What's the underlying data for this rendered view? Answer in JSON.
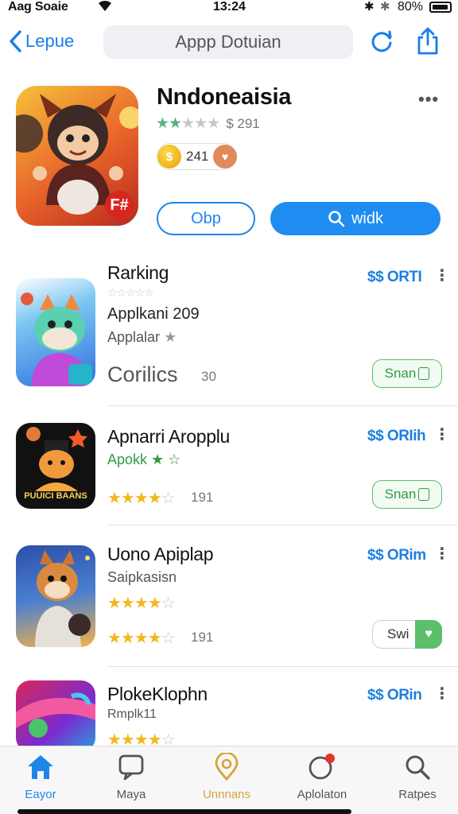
{
  "status_bar": {
    "carrier": "Aag Soaie",
    "time": "13:24",
    "battery": "80%"
  },
  "nav": {
    "back_label": "Lepue",
    "search_text": "Appp Dotuian"
  },
  "hero": {
    "title": "Nndoneaisia",
    "rating_count": "291",
    "coins": "241",
    "open_label": "Obp",
    "action_label": "widk",
    "badge": "F#"
  },
  "apps": [
    {
      "name": "Rarking",
      "line1": "Applkani 209",
      "line2": "Applalar",
      "extra": "Corilics",
      "extra_count": "30",
      "price": "$$ ORTI",
      "button": "Snan"
    },
    {
      "name": "Apnarri Aropplu",
      "line1": "Apokk",
      "icon_text": "PUUICI BAANS",
      "price": "$$ ORIih",
      "rating_count": "191",
      "button": "Snan"
    },
    {
      "name": "Uono  Apiplap",
      "line1": "Saipkasisn",
      "price": "$$ ORim",
      "rating_count": "191",
      "button": "Swi"
    },
    {
      "name": "PlokeKlophn",
      "line1": "Rmplk11",
      "price": "$$ ORin"
    }
  ],
  "tabs": [
    {
      "label": "Eayor",
      "icon": "home-icon",
      "color": "#1e86e8"
    },
    {
      "label": "Maya",
      "icon": "chat-icon",
      "color": "#555555"
    },
    {
      "label": "Unnnans",
      "icon": "location-icon",
      "color": "#d9a23a"
    },
    {
      "label": "Aplolaton",
      "icon": "updates-icon",
      "color": "#555555"
    },
    {
      "label": "Ratpes",
      "icon": "search-icon",
      "color": "#555555"
    }
  ],
  "colors": {
    "accent": "#1e8cf0",
    "price": "#1e7fe0",
    "get_green": "#2f9b45",
    "star_yellow": "#f2b81f",
    "star_green": "#58b37a"
  }
}
